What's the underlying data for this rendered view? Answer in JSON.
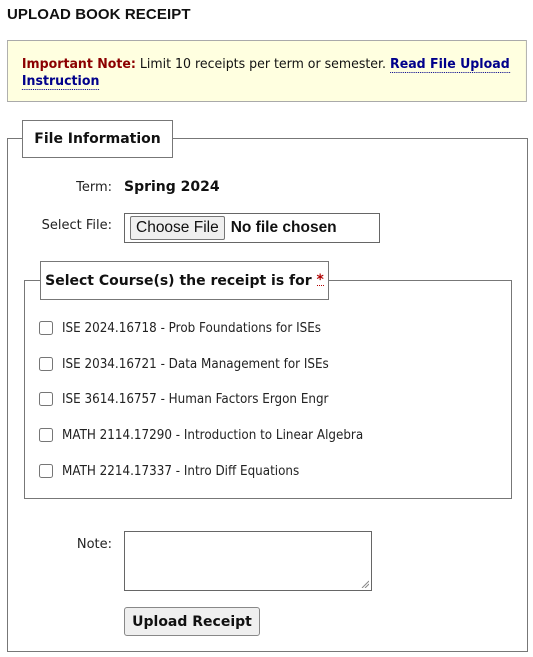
{
  "page": {
    "title": "UPLOAD BOOK RECEIPT"
  },
  "notice": {
    "label": "Important Note:",
    "text": " Limit 10 receipts per term or semester. ",
    "link_text": "Read File Upload Instruction",
    "label_color": "#8b0000",
    "link_color": "#00008b",
    "background": "#ffffe0"
  },
  "file_info": {
    "legend": "File Information",
    "term_label": "Term:",
    "term_value": "Spring 2024",
    "select_file_label": "Select File:",
    "choose_file_button": "Choose File",
    "file_status": "No file chosen"
  },
  "courses": {
    "legend": "Select Course(s) the receipt is for ",
    "required_marker": "*",
    "items": [
      {
        "label": "ISE 2024.16718 - Prob Foundations for ISEs",
        "checked": false
      },
      {
        "label": "ISE 2034.16721 - Data Management for ISEs",
        "checked": false
      },
      {
        "label": "ISE 3614.16757 - Human Factors Ergon Engr",
        "checked": false
      },
      {
        "label": "MATH 2114.17290 - Introduction to Linear Algebra",
        "checked": false
      },
      {
        "label": "MATH 2214.17337 - Intro Diff Equations",
        "checked": false
      }
    ]
  },
  "note_field": {
    "label": "Note:",
    "value": ""
  },
  "actions": {
    "upload_button": "Upload Receipt"
  }
}
